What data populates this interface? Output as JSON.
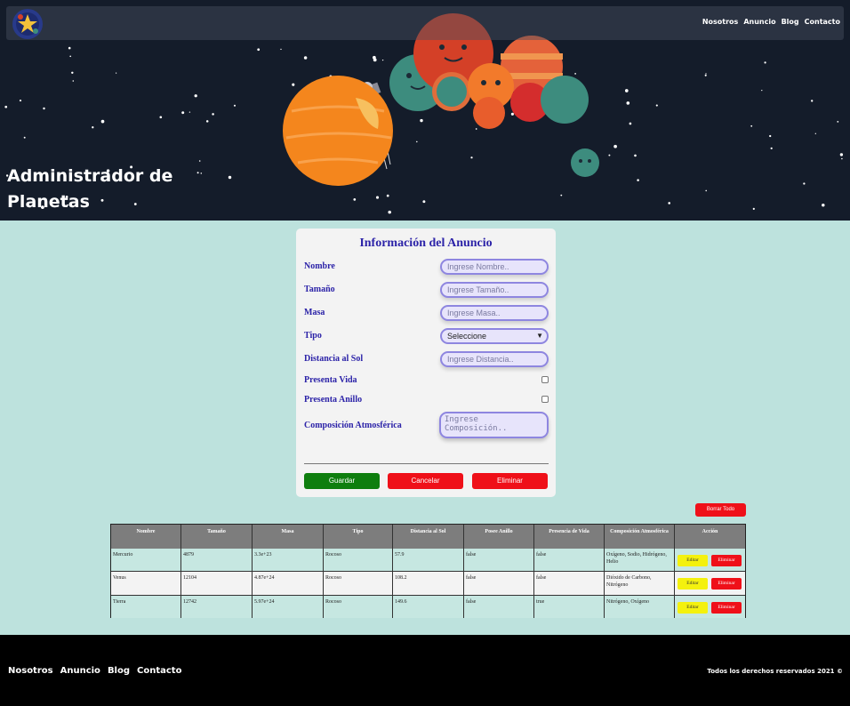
{
  "header": {
    "nav": [
      "Nosotros",
      "Anuncio",
      "Blog",
      "Contacto"
    ],
    "title": "Administrador de Planetas"
  },
  "form": {
    "title": "Información del Anuncio",
    "fields": {
      "nombre": {
        "label": "Nombre",
        "placeholder": "Ingrese Nombre.."
      },
      "tamano": {
        "label": "Tamaño",
        "placeholder": "Ingrese Tamaño.."
      },
      "masa": {
        "label": "Masa",
        "placeholder": "Ingrese Masa.."
      },
      "tipo": {
        "label": "Tipo",
        "value": "Seleccione"
      },
      "distancia": {
        "label": "Distancia al Sol",
        "placeholder": "Ingrese Distancia.."
      },
      "vida": {
        "label": "Presenta Vida"
      },
      "anillo": {
        "label": "Presenta Anillo"
      },
      "composicion": {
        "label": "Composición Atmosférica",
        "placeholder": "Ingrese Composición.."
      }
    },
    "buttons": {
      "save": "Guardar",
      "cancel": "Cancelar",
      "delete": "Eliminar"
    }
  },
  "table": {
    "delete_all": "Borrar Todo",
    "headers": [
      "Nombre",
      "Tamaño",
      "Masa",
      "Tipo",
      "Distancia al Sol",
      "Posee Anillo",
      "Presencia de Vida",
      "Composición Atmosférica",
      "Acción"
    ],
    "rows": [
      {
        "nombre": "Mercurio",
        "tamano": "4879",
        "masa": "3.3e+23",
        "tipo": "Rocoso",
        "distancia": "57.9",
        "anillo": "false",
        "vida": "false",
        "composicion": "Oxígeno, Sodio, Hidrógeno, Helio"
      },
      {
        "nombre": "Venus",
        "tamano": "12104",
        "masa": "4.87e+24",
        "tipo": "Rocoso",
        "distancia": "108.2",
        "anillo": "false",
        "vida": "false",
        "composicion": "Dióxido de Carbono, Nitrógeno"
      },
      {
        "nombre": "Tierra",
        "tamano": "12742",
        "masa": "5.97e+24",
        "tipo": "Rocoso",
        "distancia": "149.6",
        "anillo": "false",
        "vida": "true",
        "composicion": "Nitrógeno, Oxígeno"
      }
    ],
    "edit_label": "Editar",
    "delete_label": "Eliminar"
  },
  "footer": {
    "nav": [
      "Nosotros",
      "Anuncio",
      "Blog",
      "Contacto"
    ],
    "copyright": "Todos los derechos reservados 2021 ©"
  },
  "colors": {
    "accent": "#2c23a8",
    "save": "#0e7e0e",
    "danger": "#ef1019",
    "edit": "#f4f10e",
    "background": "#bde2dd"
  },
  "icons": {
    "logo": "planet-logo-icon"
  }
}
